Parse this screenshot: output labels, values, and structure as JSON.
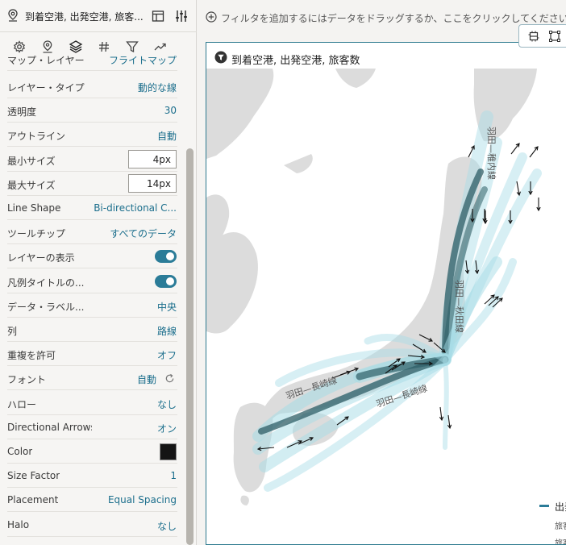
{
  "panel": {
    "title": "到着空港, 出発空港, 旅客...",
    "tabs": [
      "settings-tab",
      "map-tab",
      "layers-tab",
      "number-format-tab",
      "filter-tab",
      "analytics-tab"
    ],
    "cut_row": {
      "label": "マップ・レイヤー",
      "value": "フライトマップ"
    },
    "properties": [
      {
        "label": "レイヤー・タイプ",
        "value": "動的な線",
        "kind": "text"
      },
      {
        "label": "透明度",
        "value": "30",
        "kind": "text"
      },
      {
        "label": "アウトライン",
        "value": "自動",
        "kind": "text"
      },
      {
        "label": "最小サイズ",
        "value": "4px",
        "kind": "input"
      },
      {
        "label": "最大サイズ",
        "value": "14px",
        "kind": "input"
      },
      {
        "label": "Line Shape",
        "value": "Bi-directional C...",
        "kind": "text"
      },
      {
        "label": "ツールチップ",
        "value": "すべてのデータ",
        "kind": "text"
      },
      {
        "label": "レイヤーの表示",
        "value": "on",
        "kind": "toggle"
      },
      {
        "label": "凡例タイトルの...",
        "value": "on",
        "kind": "toggle"
      },
      {
        "label": "データ・ラベル...",
        "value": "中央",
        "kind": "text"
      },
      {
        "label": "列",
        "value": "路線",
        "kind": "text"
      },
      {
        "label": "重複を許可",
        "value": "オフ",
        "kind": "text"
      },
      {
        "label": "フォント",
        "value": "自動",
        "kind": "font"
      },
      {
        "label": "ハロー",
        "value": "なし",
        "kind": "text"
      },
      {
        "label": "Directional Arrows",
        "value": "オン",
        "kind": "text"
      },
      {
        "label": "Color",
        "value": "#141414",
        "kind": "swatch"
      },
      {
        "label": "Size Factor",
        "value": "1",
        "kind": "text"
      },
      {
        "label": "Placement",
        "value": "Equal Spacing",
        "kind": "text"
      },
      {
        "label": "Halo",
        "value": "なし",
        "kind": "text"
      }
    ]
  },
  "filterbar": {
    "placeholder": "フィルタを追加するにはデータをドラッグするか、ここをクリックしてください"
  },
  "visualization": {
    "title": "到着空港, 出発空港, 旅客数",
    "route_labels": [
      "羽田—稚内線",
      "羽田—秋田線",
      "羽田—長崎線",
      "羽田—長崎線"
    ],
    "legend": {
      "label": "出発",
      "sub1": "旅客",
      "sub2": "旅客"
    }
  },
  "colors": {
    "accent": "#2b7c98",
    "land": "#dcdcdc",
    "route_light": "#a6dce6",
    "route_dark": "#2e5e66"
  }
}
